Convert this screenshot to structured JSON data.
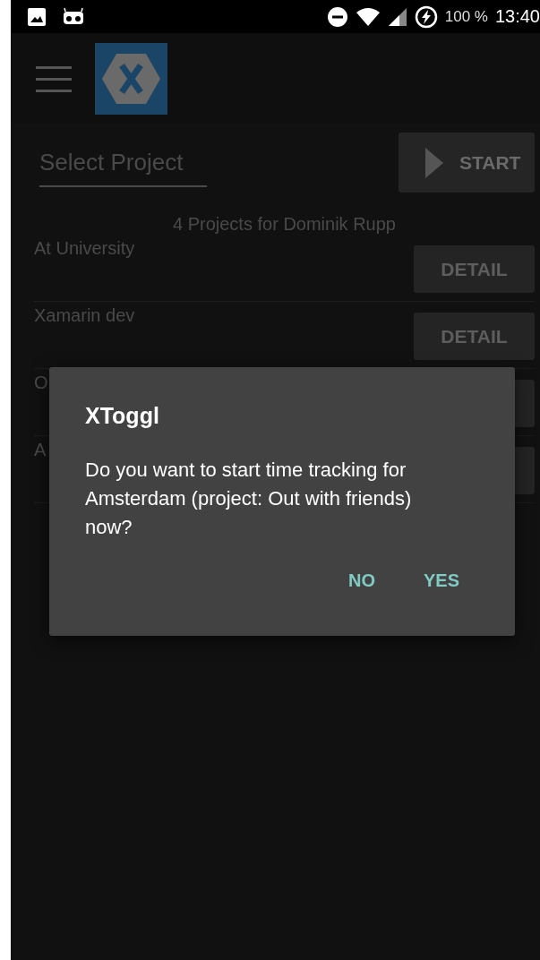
{
  "status_bar": {
    "battery": "100 %",
    "time": "13:40"
  },
  "project_picker": {
    "placeholder": "Select Project"
  },
  "start_button": {
    "label": "START"
  },
  "projects_heading": "4 Projects for Dominik Rupp",
  "projects": [
    {
      "name": "At University",
      "detail_label": "DETAIL"
    },
    {
      "name": "Xamarin dev",
      "detail_label": "DETAIL"
    },
    {
      "name": "O"
    },
    {
      "name": "A"
    }
  ],
  "dialog": {
    "title": "XToggl",
    "message": "Do you want to start time tracking for Amsterdam (project: Out with friends) now?",
    "buttons": [
      "NO",
      "YES"
    ]
  }
}
